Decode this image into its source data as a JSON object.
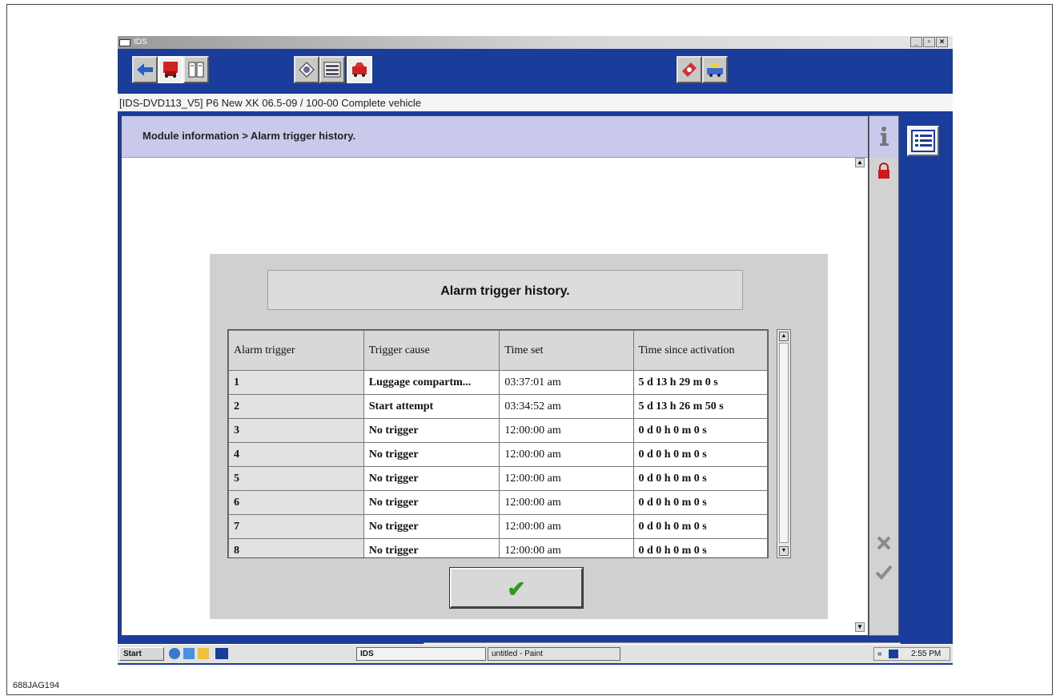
{
  "window": {
    "title": "IDS",
    "controls": [
      "_",
      "&#x25AB;",
      "X"
    ]
  },
  "toolbar": {
    "left_icons": [
      "back-arrow-icon",
      "vehicle-info-icon",
      "document-icon"
    ],
    "mid_icons": [
      "diagnostic-tag-icon",
      "module-list-icon",
      "vehicle-tools-icon"
    ],
    "right_icons": [
      "toolbox-icon",
      "vehicle-config-icon"
    ]
  },
  "infobar": {
    "session_text": "[IDS-DVD113_V5] P6  New XK 06.5-09 / 100-00 Complete vehicle"
  },
  "breadcrumb": {
    "text": "Module information > Alarm trigger history."
  },
  "dialog": {
    "title": "Alarm trigger history.",
    "columns": [
      "Alarm trigger",
      "Trigger cause",
      "Time set",
      "Time since activation"
    ],
    "rows": [
      [
        "1",
        "Luggage compartm...",
        "03:37:01 am",
        "5 d 13 h 29 m 0 s"
      ],
      [
        "2",
        "Start attempt",
        "03:34:52 am",
        "5 d 13 h 26 m 50 s"
      ],
      [
        "3",
        "No trigger",
        "12:00:00 am",
        "0 d 0 h 0 m 0 s"
      ],
      [
        "4",
        "No trigger",
        "12:00:00 am",
        "0 d 0 h 0 m 0 s"
      ],
      [
        "5",
        "No trigger",
        "12:00:00 am",
        "0 d 0 h 0 m 0 s"
      ],
      [
        "6",
        "No trigger",
        "12:00:00 am",
        "0 d 0 h 0 m 0 s"
      ],
      [
        "7",
        "No trigger",
        "12:00:00 am",
        "0 d 0 h 0 m 0 s"
      ],
      [
        "8",
        "No trigger",
        "12:00:00 am",
        "0 d 0 h 0 m 0 s"
      ]
    ],
    "ok_symbol": "✔"
  },
  "sidebar": {
    "icons": [
      "info-icon",
      "lock-icon",
      "cancel-x-icon",
      "confirm-check-icon"
    ]
  },
  "taskbar": {
    "start_label": "Start",
    "tasks": [
      "IDS",
      "untitled - Paint"
    ],
    "tray_chevron": "«",
    "clock": "2:55 PM"
  },
  "figure": {
    "code": "688JAG194"
  },
  "colors": {
    "window_blue": "#1a3d9c",
    "breadcrumb_lavender": "#c9c9eb",
    "dialog_gray": "#d0d0d0",
    "ok_green": "#2f9a1a"
  }
}
